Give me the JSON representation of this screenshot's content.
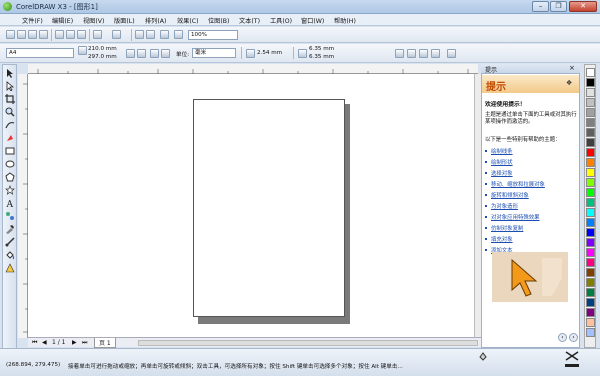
{
  "window": {
    "title": "CorelDRAW X3 - [图形1]",
    "minimize_glyph": "–",
    "restore_glyph": "❐",
    "close_glyph": "✕"
  },
  "menubar": {
    "items": [
      "文件(F)",
      "编辑(E)",
      "视图(V)",
      "版面(L)",
      "排列(A)",
      "效果(C)",
      "位图(B)",
      "文本(T)",
      "工具(O)",
      "窗口(W)",
      "帮助(H)"
    ]
  },
  "standard_toolbar": {
    "zoom_value": "100%"
  },
  "property_bar": {
    "paper_size": "A4",
    "width": "210.0 mm",
    "height": "297.0 mm",
    "units_label": "单位:",
    "units_value": "毫米",
    "nudge": "2.54 mm",
    "dup_x": "6.35 mm",
    "dup_y": "6.35 mm"
  },
  "page_nav": {
    "page_counter": "1 / 1",
    "page_tab": "页 1"
  },
  "docker": {
    "tab_label": "提示",
    "header_title": "提示",
    "welcome": "欢迎使用提示！",
    "intro": "主题是通过单击下面的工具或对其执行某项操作而激活的。",
    "list_intro": "以下是一些特别有帮助的主题：",
    "links": [
      "绘制线条",
      "绘制形状",
      "选择对象",
      "移动、缩放和拉展对象",
      "旋转和倾斜对象",
      "为对象造形",
      "对对象应用特殊效果",
      "仿制对象复制",
      "填充对象",
      "添加文本"
    ]
  },
  "palette": {
    "colors": [
      "#ffffff",
      "#000000",
      "#e0e0e0",
      "#c0c0c0",
      "#a0a0a0",
      "#808080",
      "#606060",
      "#404040",
      "#ff0000",
      "#ff8000",
      "#ffff00",
      "#80ff00",
      "#00ff00",
      "#00c080",
      "#00ffff",
      "#0080ff",
      "#0000ff",
      "#8000ff",
      "#ff00ff",
      "#ff0080",
      "#804000",
      "#808000",
      "#008040",
      "#004080",
      "#800080",
      "#ffc0a0",
      "#a0c0ff"
    ]
  },
  "status": {
    "coordinates": "(268.894, 279.475)",
    "hint": "接着单击可进行拖动或缩放；再单击可旋转或倾斜；双击工具，可选择所有对象；按住 Shift 键单击可选择多个对象；按住 Alt 键单击..."
  },
  "accent_colors": {
    "titlebar": "#aec8e6",
    "docker_header": "#f3c98a",
    "link": "#1d4fb3"
  }
}
